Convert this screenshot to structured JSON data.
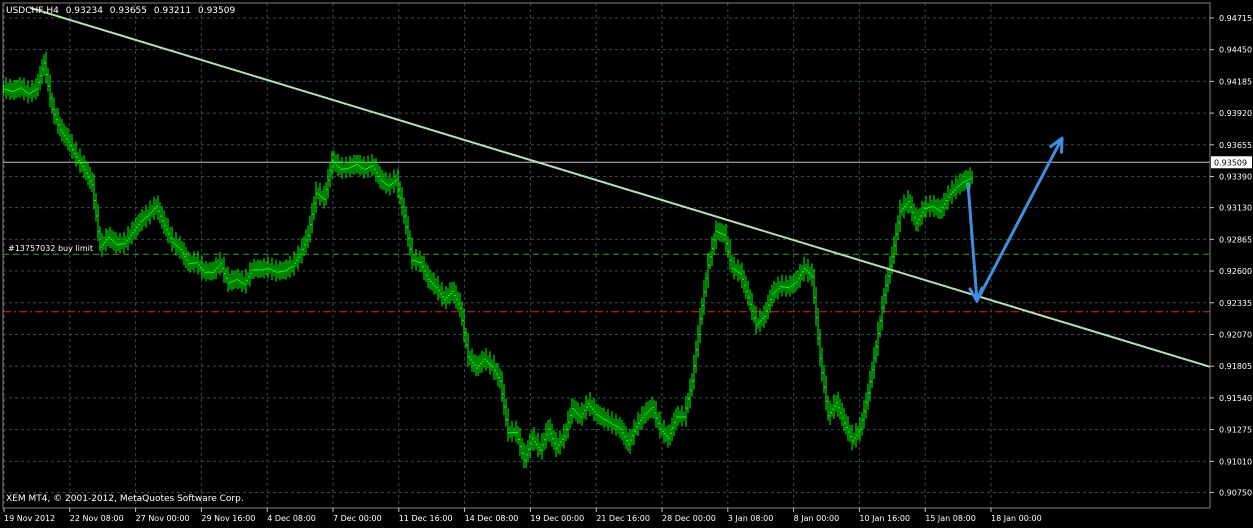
{
  "header": {
    "symbol": "USDCHF,H4",
    "open": "0.93234",
    "high": "0.93655",
    "low": "0.93211",
    "close": "0.93509"
  },
  "footer": {
    "copyright": "XEM MT4, © 2001-2012, MetaQuotes Software Corp."
  },
  "order_label": "#13757032 buy limit",
  "current_price_label": "0.93509",
  "colors": {
    "background": "#000000",
    "grid": "#2f4f4f",
    "candle": "#00ff00",
    "trendline": "#b4e0b4",
    "arrow": "#3f8fe0",
    "buy_limit_line": "#3a9a3a",
    "red_line": "#e02020",
    "price_line": "#c0c0c0",
    "text": "#ffffff"
  },
  "chart_data": {
    "type": "line",
    "title": "USDCHF,H4",
    "ylim": [
      0.9062,
      0.9484
    ],
    "y_ticks": [
      "0.94715",
      "0.94450",
      "0.94185",
      "0.93920",
      "0.93655",
      "0.93390",
      "0.93130",
      "0.92865",
      "0.92600",
      "0.92335",
      "0.92070",
      "0.91805",
      "0.91540",
      "0.91275",
      "0.91010",
      "0.90750"
    ],
    "x_ticks": [
      "19 Nov 2012",
      "22 Nov 08:00",
      "27 Nov 00:00",
      "29 Nov 16:00",
      "4 Dec 08:00",
      "7 Dec 00:00",
      "11 Dec 16:00",
      "14 Dec 08:00",
      "19 Dec 00:00",
      "21 Dec 16:00",
      "28 Dec 00:00",
      "3 Jan 08:00",
      "8 Jan 00:00",
      "10 Jan 16:00",
      "15 Jan 08:00",
      "18 Jan 00:00"
    ],
    "grid": true,
    "series": [
      {
        "x": [
          0,
          8,
          16,
          24,
          32,
          40,
          48,
          56,
          64,
          72,
          80,
          88,
          96,
          104,
          112,
          120,
          128,
          136,
          144,
          152,
          160,
          168,
          176,
          184,
          192,
          200,
          208,
          216,
          224,
          232,
          240,
          248,
          256,
          264,
          272,
          280,
          288,
          296,
          304,
          312,
          320,
          328,
          336,
          344,
          352,
          360,
          368,
          376,
          384,
          392,
          400,
          408,
          416,
          424,
          432,
          440,
          448,
          456,
          464,
          472,
          480,
          488,
          496,
          504,
          512,
          520,
          528,
          536,
          544,
          552,
          560,
          568,
          576,
          584,
          592,
          600,
          608,
          616,
          624,
          632,
          640,
          648,
          656,
          664,
          672,
          680,
          688,
          696,
          704,
          712,
          720,
          728,
          736,
          744,
          752,
          760,
          768,
          776,
          784,
          792,
          800,
          808,
          816,
          824,
          832,
          840,
          848,
          856,
          864,
          872,
          880,
          888,
          896,
          904,
          912,
          920,
          928,
          936,
          944,
          952,
          960,
          968
        ],
        "y": [
          0.9412,
          0.941,
          0.9413,
          0.9408,
          0.9412,
          0.9434,
          0.9395,
          0.9378,
          0.9368,
          0.9355,
          0.9345,
          0.9332,
          0.928,
          0.9288,
          0.9282,
          0.9283,
          0.9292,
          0.9301,
          0.9307,
          0.9314,
          0.9298,
          0.9284,
          0.9278,
          0.9266,
          0.9267,
          0.9259,
          0.9259,
          0.9266,
          0.925,
          0.9253,
          0.9249,
          0.9261,
          0.9261,
          0.9262,
          0.9259,
          0.926,
          0.9264,
          0.9274,
          0.929,
          0.9325,
          0.932,
          0.9352,
          0.9345,
          0.9346,
          0.9349,
          0.9345,
          0.9348,
          0.9336,
          0.9331,
          0.9336,
          0.9306,
          0.9269,
          0.9267,
          0.9253,
          0.9246,
          0.9236,
          0.9243,
          0.9229,
          0.9188,
          0.9179,
          0.9186,
          0.918,
          0.9168,
          0.9125,
          0.9125,
          0.9102,
          0.912,
          0.911,
          0.9128,
          0.9112,
          0.9122,
          0.9145,
          0.9138,
          0.9149,
          0.914,
          0.9136,
          0.9132,
          0.9128,
          0.9115,
          0.913,
          0.914,
          0.9146,
          0.9128,
          0.912,
          0.9138,
          0.9138,
          0.9168,
          0.922,
          0.9265,
          0.9293,
          0.929,
          0.9262,
          0.9258,
          0.9238,
          0.9215,
          0.9222,
          0.9241,
          0.9247,
          0.9246,
          0.9251,
          0.9262,
          0.9255,
          0.9187,
          0.9139,
          0.915,
          0.9133,
          0.9118,
          0.9128,
          0.9158,
          0.9197,
          0.924,
          0.9272,
          0.931,
          0.9318,
          0.93,
          0.9312,
          0.9314,
          0.931,
          0.9322,
          0.933,
          0.9335,
          0.9338
        ]
      }
    ]
  }
}
